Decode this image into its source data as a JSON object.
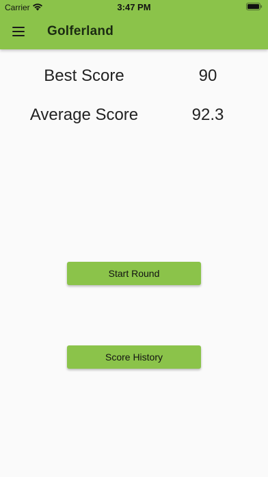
{
  "status_bar": {
    "carrier": "Carrier",
    "time": "3:47 PM",
    "wifi_icon": "wifi-icon",
    "battery_icon": "battery-icon"
  },
  "app_bar": {
    "title": "Golferland",
    "menu_icon": "hamburger-menu-icon",
    "color": "#8bc34a"
  },
  "stats": {
    "best_label": "Best Score",
    "best_value": "90",
    "average_label": "Average Score",
    "average_value": "92.3"
  },
  "actions": {
    "start_round_label": "Start Round",
    "score_history_label": "Score History"
  }
}
